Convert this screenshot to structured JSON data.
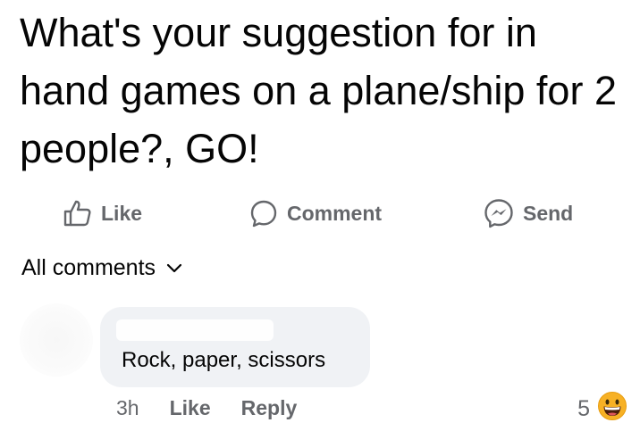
{
  "post": {
    "text": "What's your suggestion for in hand games on a plane/ship for 2 people?, GO!"
  },
  "actions": {
    "like_label": "Like",
    "comment_label": "Comment",
    "send_label": "Send"
  },
  "comments": {
    "sort_label": "All comments",
    "items": [
      {
        "text": "Rock, paper, scissors",
        "time": "3h",
        "like_label": "Like",
        "reply_label": "Reply",
        "reaction_count": "5",
        "reaction_icon": "grinning-face-emoji"
      }
    ]
  },
  "colors": {
    "secondary_text": "#65676b",
    "bubble_bg": "#f0f2f5",
    "emoji_yellow": "#f7b125"
  }
}
